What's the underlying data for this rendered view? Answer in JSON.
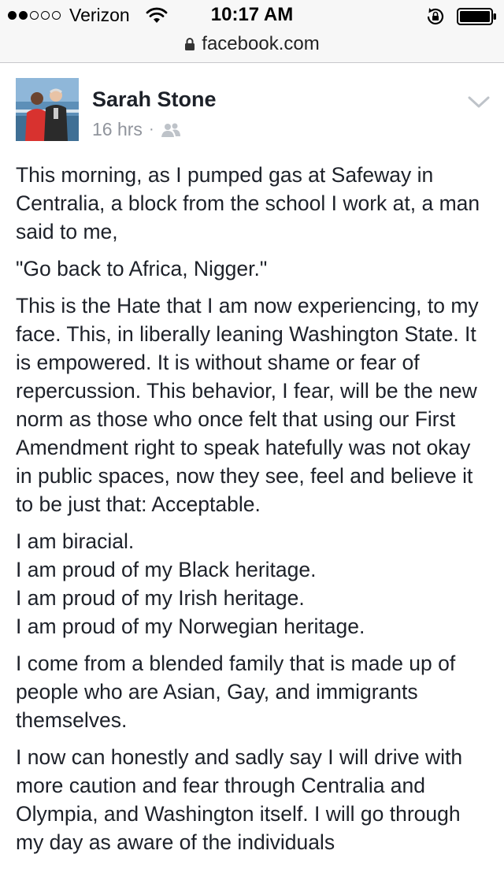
{
  "status_bar": {
    "carrier": "Verizon",
    "time": "10:17 AM",
    "signal_bars_filled": 2,
    "signal_bars_total": 5
  },
  "url_bar": {
    "url": "facebook.com"
  },
  "post": {
    "author": "Sarah Stone",
    "time": "16 hrs",
    "separator": "·",
    "privacy_icon": "friends-icon",
    "paragraphs": [
      "This morning, as I pumped gas at Safeway in Centralia, a block from the school I work at, a man said to me,",
      "\"Go back to Africa, Nigger.\"",
      "This is the Hate that I am now experiencing, to my face. This, in liberally leaning Washington State. It is empowered. It is without shame or fear of repercussion. This behavior, I fear, will be the new norm as those who once felt that using our First Amendment right to speak hatefully was not okay in public spaces, now they see, feel and believe it to be just that: Acceptable.",
      {
        "lines": [
          "I am biracial.",
          "I am proud of my Black heritage.",
          "I am proud of my Irish heritage.",
          "I am proud of my Norwegian heritage."
        ]
      },
      "I come from a blended family that is made up of people who are Asian, Gay, and immigrants themselves.",
      "I now can honestly and sadly say I will drive with more caution and fear through Centralia and Olympia, and Washington itself. I will go through my day as aware of the individuals"
    ]
  },
  "colors": {
    "chrome_bg": "#f7f7f7",
    "text": "#1d2129",
    "meta_text": "#90949c"
  }
}
